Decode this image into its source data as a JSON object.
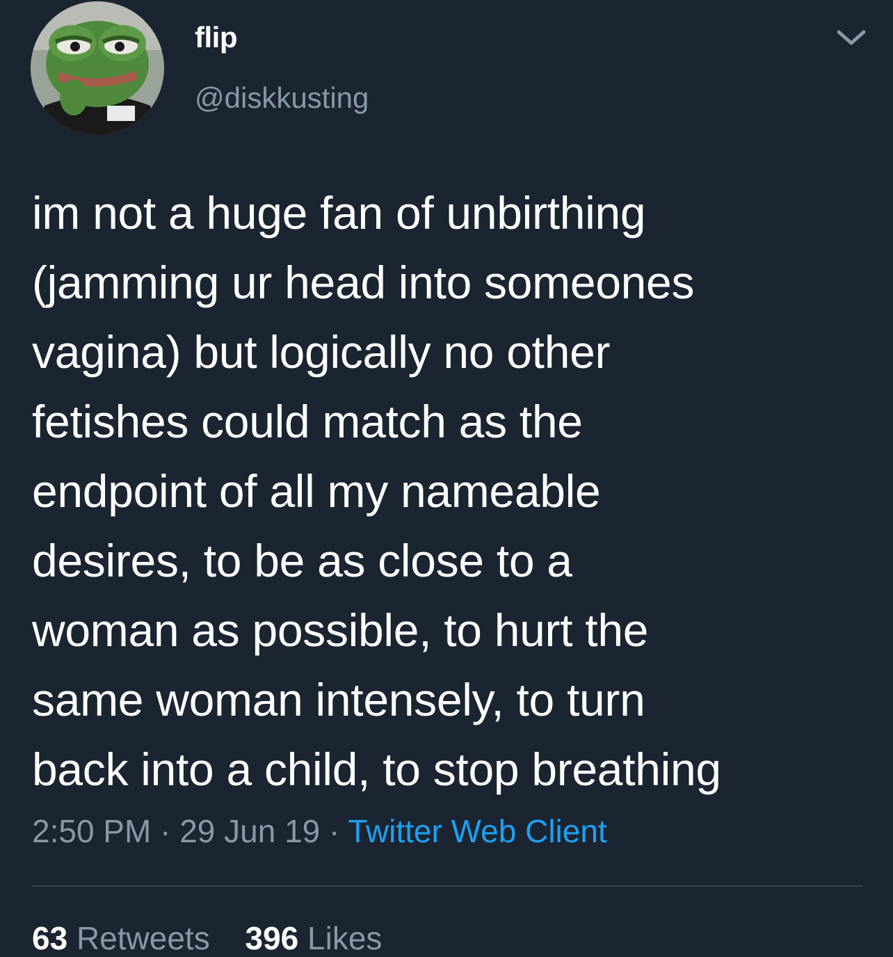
{
  "user": {
    "display_name": "flip",
    "handle": "@diskkusting",
    "avatar_icon": "frog-avatar"
  },
  "tweet": {
    "lines": [
      "im not a huge fan of unbirthing",
      "(jamming ur head into someones",
      "vagina) but logically no other",
      "fetishes could match as the",
      "endpoint of all my nameable",
      "desires, to be as close to a",
      "woman as possible, to hurt the",
      "same woman intensely, to turn",
      "back into a child, to stop breathing"
    ]
  },
  "meta": {
    "time": "2:50 PM",
    "separator": "·",
    "date": "29 Jun 19",
    "source": "Twitter Web Client"
  },
  "stats": {
    "retweets_count": "63",
    "retweets_label": "Retweets",
    "likes_count": "396",
    "likes_label": "Likes"
  },
  "colors": {
    "background": "#1b2431",
    "text": "#ffffff",
    "secondary": "#8899a6",
    "accent": "#1da1f2"
  }
}
